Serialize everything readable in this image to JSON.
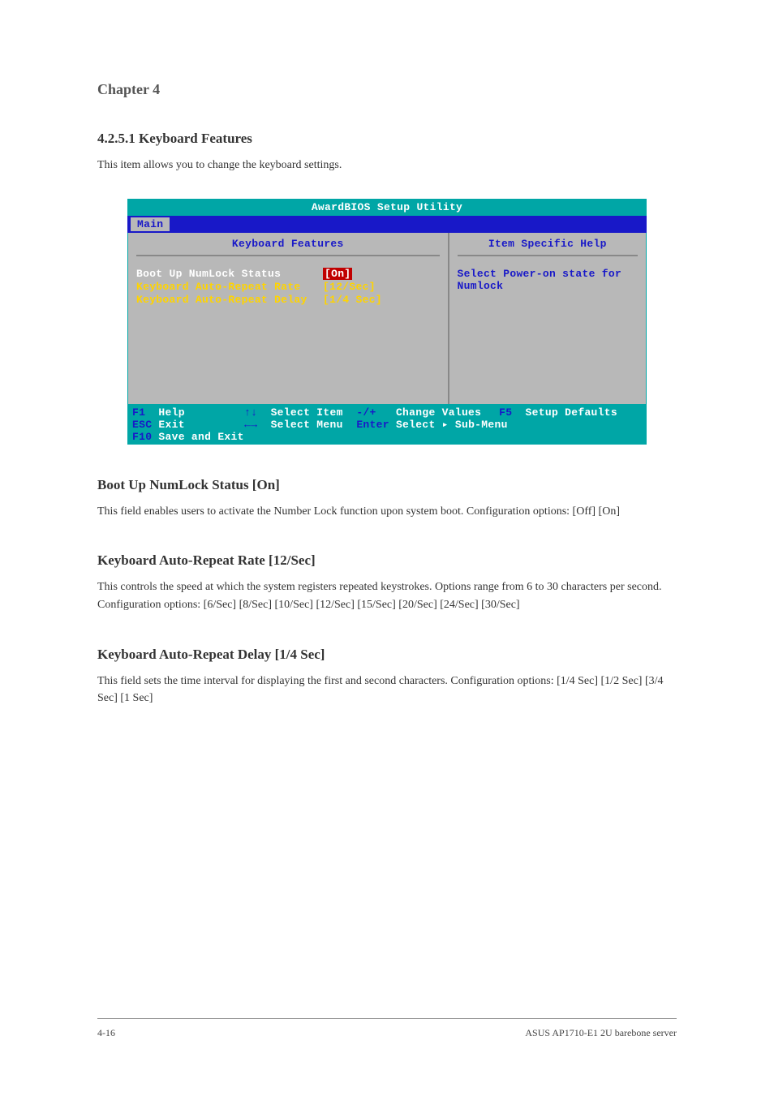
{
  "chapter_title": "Chapter 4",
  "section_title": "4.2.5.1 Keyboard Features",
  "body_text": "This item allows you to change the keyboard settings.",
  "bios": {
    "header": "AwardBIOS Setup Utility",
    "tab": "Main",
    "left_title": "Keyboard Features",
    "right_title": "Item Specific Help",
    "rows": [
      {
        "label": "Boot Up NumLock Status",
        "value": "[On]",
        "selected": true
      },
      {
        "label": "Keyboard Auto-Repeat Rate",
        "value": "[12/Sec]",
        "selected": false
      },
      {
        "label": "Keyboard Auto-Repeat Delay",
        "value": "[1/4 Sec]",
        "selected": false
      }
    ],
    "help_text": "Select Power-on state for Numlock",
    "footer": {
      "f1_key": "F1",
      "f1_label": "Help",
      "esc_key": "ESC",
      "esc_label": "Exit",
      "updown_key": "↑↓",
      "updown_label": "Select Item",
      "leftright_key": "←→",
      "leftright_label": "Select Menu",
      "pm_key": "-/+",
      "pm_label": "Change Values",
      "enter_key": "Enter",
      "enter_label": "Select ▸ Sub-Menu",
      "f5_key": "F5",
      "f5_label": "Setup Defaults",
      "f10_key": "F10",
      "f10_label": "Save and Exit"
    }
  },
  "options": {
    "numlock": {
      "heading": "Boot Up NumLock Status [On]",
      "text": "This field enables users to activate the Number Lock function upon system boot. Configuration options: [Off] [On]"
    },
    "rate": {
      "heading": "Keyboard Auto-Repeat Rate [12/Sec]",
      "text": "This controls the speed at which the system registers repeated keystrokes. Options range from 6 to 30 characters per second. Configuration options: [6/Sec] [8/Sec] [10/Sec] [12/Sec] [15/Sec] [20/Sec] [24/Sec] [30/Sec]"
    },
    "delay": {
      "heading": "Keyboard Auto-Repeat Delay [1/4 Sec]",
      "text": "This field sets the time interval for displaying the first and second characters. Configuration options: [1/4 Sec] [1/2 Sec] [3/4 Sec] [1 Sec]"
    }
  },
  "footer_left": "4-16",
  "footer_right": "ASUS AP1710-E1 2U barebone server"
}
